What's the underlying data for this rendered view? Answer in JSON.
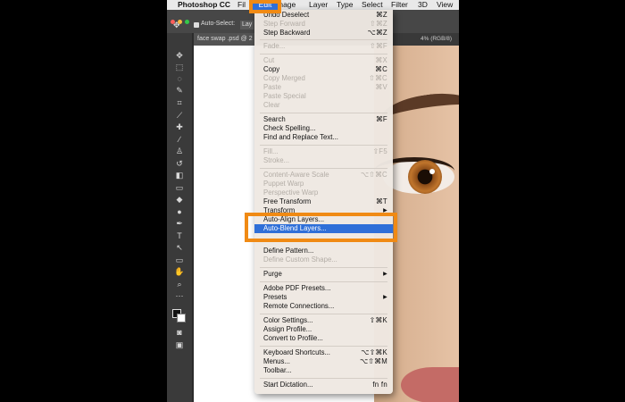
{
  "app": {
    "name": "Photoshop CC",
    "menus": [
      "File",
      "Edit",
      "Image",
      "Layer",
      "Type",
      "Select",
      "Filter",
      "3D",
      "View"
    ],
    "menu_visible_text": {
      "file": "Fil",
      "image": "mage"
    }
  },
  "options_bar": {
    "auto_select": "Auto-Select:",
    "layer_dropdown": "Lay"
  },
  "document": {
    "tab_title": "face swap .psd @ 2",
    "tab_status_right": "4% (RGB/8)"
  },
  "edit_menu": {
    "items": [
      {
        "label": "Undo Deselect",
        "shortcut": "⌘Z",
        "enabled": true
      },
      {
        "label": "Step Forward",
        "shortcut": "⇧⌘Z",
        "enabled": false
      },
      {
        "label": "Step Backward",
        "shortcut": "⌥⌘Z",
        "enabled": true
      },
      {
        "label": "Fade...",
        "shortcut": "⇧⌘F",
        "enabled": false
      },
      {
        "label": "Cut",
        "shortcut": "⌘X",
        "enabled": false
      },
      {
        "label": "Copy",
        "shortcut": "⌘C",
        "enabled": true
      },
      {
        "label": "Copy Merged",
        "shortcut": "⇧⌘C",
        "enabled": false
      },
      {
        "label": "Paste",
        "shortcut": "⌘V",
        "enabled": false
      },
      {
        "label": "Paste Special",
        "shortcut": "",
        "enabled": false
      },
      {
        "label": "Clear",
        "shortcut": "",
        "enabled": false
      },
      {
        "label": "Search",
        "shortcut": "⌘F",
        "enabled": true
      },
      {
        "label": "Check Spelling...",
        "shortcut": "",
        "enabled": true
      },
      {
        "label": "Find and Replace Text...",
        "shortcut": "",
        "enabled": true
      },
      {
        "label": "Fill...",
        "shortcut": "⇧F5",
        "enabled": false
      },
      {
        "label": "Stroke...",
        "shortcut": "",
        "enabled": false
      },
      {
        "label": "Content-Aware Scale",
        "shortcut": "⌥⇧⌘C",
        "enabled": false
      },
      {
        "label": "Puppet Warp",
        "shortcut": "",
        "enabled": false
      },
      {
        "label": "Perspective Warp",
        "shortcut": "",
        "enabled": false
      },
      {
        "label": "Free Transform",
        "shortcut": "⌘T",
        "enabled": true
      },
      {
        "label": "Transform",
        "shortcut": "",
        "enabled": true
      },
      {
        "label": "Auto-Align Layers...",
        "shortcut": "",
        "enabled": true
      },
      {
        "label": "Auto-Blend Layers...",
        "shortcut": "",
        "enabled": true
      },
      {
        "label": "Define Pattern...",
        "shortcut": "",
        "enabled": true
      },
      {
        "label": "Define Custom Shape...",
        "shortcut": "",
        "enabled": false
      },
      {
        "label": "Purge",
        "shortcut": "",
        "enabled": true
      },
      {
        "label": "Adobe PDF Presets...",
        "shortcut": "",
        "enabled": true
      },
      {
        "label": "Presets",
        "shortcut": "",
        "enabled": true
      },
      {
        "label": "Remote Connections...",
        "shortcut": "",
        "enabled": true
      },
      {
        "label": "Color Settings...",
        "shortcut": "⇧⌘K",
        "enabled": true
      },
      {
        "label": "Assign Profile...",
        "shortcut": "",
        "enabled": true
      },
      {
        "label": "Convert to Profile...",
        "shortcut": "",
        "enabled": true
      },
      {
        "label": "Keyboard Shortcuts...",
        "shortcut": "⌥⇧⌘K",
        "enabled": true
      },
      {
        "label": "Menus...",
        "shortcut": "⌥⇧⌘M",
        "enabled": true
      },
      {
        "label": "Toolbar...",
        "shortcut": "",
        "enabled": true
      },
      {
        "label": "Start Dictation...",
        "shortcut": "fn fn",
        "enabled": true
      }
    ],
    "submenu_arrow": "▶",
    "highlighted": "Auto-Blend Layers..."
  },
  "colors": {
    "highlight_border": "#f08a14",
    "selection_blue": "#2f6fd8"
  }
}
